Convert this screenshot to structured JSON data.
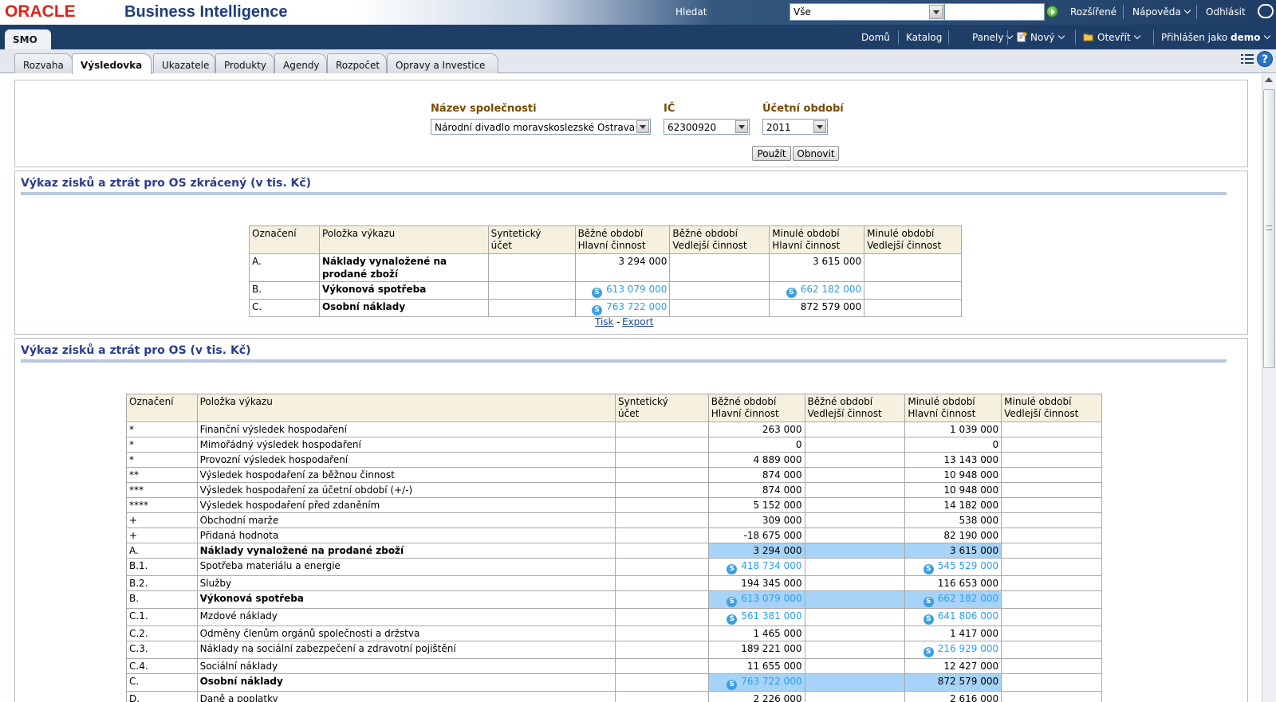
{
  "header": {
    "oracle_logo": "ORACLE",
    "product_title": "Business Intelligence",
    "search_label": "Hledat",
    "search_scope": "Vše",
    "advanced": "Rozšířené",
    "help": "Nápověda",
    "signout": "Odhlásit"
  },
  "navbar": {
    "dashboard_tab": "SMO",
    "home": "Domů",
    "catalog": "Katalog",
    "dashboards": "Panely",
    "new": "Nový",
    "open": "Otevřít",
    "signed_in_as": "Přihlášen jako",
    "user": "demo"
  },
  "tabs": [
    "Rozvaha",
    "Výsledovka",
    "Ukazatele",
    "Produkty",
    "Agendy",
    "Rozpočet",
    "Opravy a Investice"
  ],
  "active_tab": "Výsledovka",
  "prompts": {
    "company_label": "Název společnosti",
    "company_value": "Národní divadlo moravskoslezské Ostrava",
    "ic_label": "IČ",
    "ic_value": "62300920",
    "period_label": "Účetní období",
    "period_value": "2011",
    "apply": "Použít",
    "reset": "Obnovit"
  },
  "report1": {
    "title": "Výkaz zisků a ztrát pro OS zkrácený (v tis. Kč)",
    "headers": [
      "Označení",
      "Položka výkazu",
      "Syntetický\núčet",
      "Běžné období\nHlavní činnost",
      "Běžné období\nVedlejší činnost",
      "Minulé období\nHlavní činnost",
      "Minulé období\nVedlejší činnost"
    ],
    "rows": [
      {
        "code": "A.",
        "item": "Náklady vynaložené na prodané zboží",
        "bold": true,
        "cur": "3 294 000",
        "cur_link": false,
        "prev": "3 615 000",
        "prev_link": false
      },
      {
        "code": "B.",
        "item": "Výkonová spotřeba",
        "bold": true,
        "cur": "613 079 000",
        "cur_link": true,
        "prev": "662 182 000",
        "prev_link": true
      },
      {
        "code": "C.",
        "item": "Osobní náklady",
        "bold": true,
        "cur": "763 722 000",
        "cur_link": true,
        "prev": "872 579 000",
        "prev_link": false
      }
    ],
    "print": "Tisk",
    "export": "Export"
  },
  "report2": {
    "title": "Výkaz zisků a ztrát pro OS (v tis. Kč)",
    "headers": [
      "Označení",
      "Položka výkazu",
      "Syntetický\núčet",
      "Běžné období\nHlavní činnost",
      "Běžné období\nVedlejší činnost",
      "Minulé období\nHlavní činnost",
      "Minulé období\nVedlejší činnost"
    ],
    "rows": [
      {
        "code": "*",
        "item": "Finanční výsledek hospodaření",
        "bold": false,
        "hl": false,
        "cur": "263 000",
        "cur_link": false,
        "prev": "1 039 000",
        "prev_link": false
      },
      {
        "code": "*",
        "item": "Mimořádný výsledek hospodaření",
        "bold": false,
        "hl": false,
        "cur": "0",
        "cur_link": false,
        "prev": "0",
        "prev_link": false
      },
      {
        "code": "*",
        "item": "Provozní výsledek hospodaření",
        "bold": false,
        "hl": false,
        "cur": "4 889 000",
        "cur_link": false,
        "prev": "13 143 000",
        "prev_link": false
      },
      {
        "code": "**",
        "item": "Výsledek hospodaření za běžnou činnost",
        "bold": false,
        "hl": false,
        "cur": "874 000",
        "cur_link": false,
        "prev": "10 948 000",
        "prev_link": false
      },
      {
        "code": "***",
        "item": "Výsledek hospodaření za účetní období (+/-)",
        "bold": false,
        "hl": false,
        "cur": "874 000",
        "cur_link": false,
        "prev": "10 948 000",
        "prev_link": false
      },
      {
        "code": "****",
        "item": "Výsledek hospodaření před zdaněním",
        "bold": false,
        "hl": false,
        "cur": "5 152 000",
        "cur_link": false,
        "prev": "14 182 000",
        "prev_link": false
      },
      {
        "code": "+",
        "item": "Obchodní marže",
        "bold": false,
        "hl": false,
        "cur": "309 000",
        "cur_link": false,
        "prev": "538 000",
        "prev_link": false
      },
      {
        "code": "+",
        "item": "Přidaná hodnota",
        "bold": false,
        "hl": false,
        "cur": "-18 675 000",
        "cur_link": false,
        "prev": "82 190 000",
        "prev_link": false
      },
      {
        "code": "A.",
        "item": "Náklady vynaložené na prodané zboží",
        "bold": true,
        "hl": true,
        "cur": "3 294 000",
        "cur_link": false,
        "prev": "3 615 000",
        "prev_link": false
      },
      {
        "code": "B.1.",
        "item": "Spotřeba materiálu a energie",
        "bold": false,
        "hl": false,
        "cur": "418 734 000",
        "cur_link": true,
        "prev": "545 529 000",
        "prev_link": true
      },
      {
        "code": "B.2.",
        "item": "Služby",
        "bold": false,
        "hl": false,
        "cur": "194 345 000",
        "cur_link": false,
        "prev": "116 653 000",
        "prev_link": false
      },
      {
        "code": "B.",
        "item": "Výkonová spotřeba",
        "bold": true,
        "hl": true,
        "cur": "613 079 000",
        "cur_link": true,
        "prev": "662 182 000",
        "prev_link": true
      },
      {
        "code": "C.1.",
        "item": "Mzdové náklady",
        "bold": false,
        "hl": false,
        "cur": "561 381 000",
        "cur_link": true,
        "prev": "641 806 000",
        "prev_link": true
      },
      {
        "code": "C.2.",
        "item": "Odměny členům orgánů společnosti a držstva",
        "bold": false,
        "hl": false,
        "cur": "1 465 000",
        "cur_link": false,
        "prev": "1 417 000",
        "prev_link": false
      },
      {
        "code": "C.3.",
        "item": "Náklady na sociální zabezpečení a zdravotní pojištění",
        "bold": false,
        "hl": false,
        "cur": "189 221 000",
        "cur_link": false,
        "prev": "216 929 000",
        "prev_link": true
      },
      {
        "code": "C.4.",
        "item": "Sociální náklady",
        "bold": false,
        "hl": false,
        "cur": "11 655 000",
        "cur_link": false,
        "prev": "12 427 000",
        "prev_link": false
      },
      {
        "code": "C.",
        "item": "Osobní náklady",
        "bold": true,
        "hl": true,
        "cur": "763 722 000",
        "cur_link": true,
        "prev": "872 579 000",
        "prev_link": false
      },
      {
        "code": "D.",
        "item": "Daně a poplatky",
        "bold": false,
        "hl": false,
        "cur": "2 226 000",
        "cur_link": false,
        "prev": "2 616 000",
        "prev_link": false
      }
    ]
  },
  "colors": {
    "header_dark": "#1f3e67",
    "row_highlight": "#a7d3f8",
    "link": "#2a9df4",
    "section_title": "#2a3d8f",
    "prompt_label": "#7a4a00",
    "table_header_bg": "#f5f1de"
  },
  "icons": [
    "search-go-icon",
    "signout-icon",
    "new-icon",
    "open-folder-icon",
    "help-icon",
    "tabs-menu-icon",
    "skype-icon"
  ]
}
